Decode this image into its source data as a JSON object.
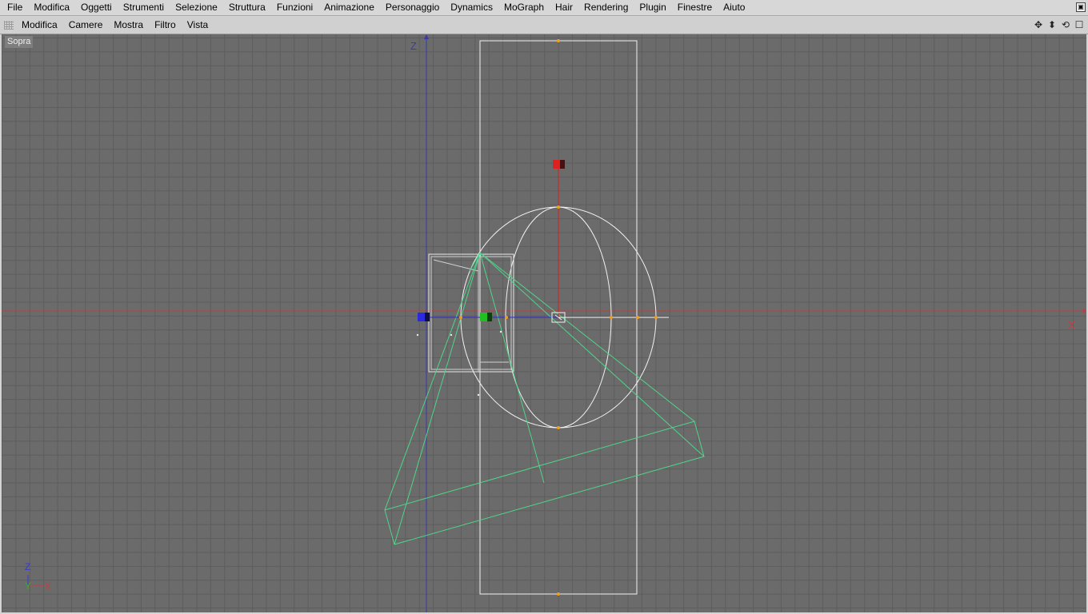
{
  "menu": [
    "File",
    "Modifica",
    "Oggetti",
    "Strumenti",
    "Selezione",
    "Struttura",
    "Funzioni",
    "Animazione",
    "Personaggio",
    "Dynamics",
    "MoGraph",
    "Hair",
    "Rendering",
    "Plugin",
    "Finestre",
    "Aiuto"
  ],
  "view_menu": [
    "Modifica",
    "Camere",
    "Mostra",
    "Filtro",
    "Vista"
  ],
  "view_icons": [
    "move-view-icon",
    "dolly-view-icon",
    "rotate-view-icon",
    "maximize-view-icon"
  ],
  "viewport": {
    "label": "Sopra",
    "axis_x_label": "X",
    "axis_z_label": "Z",
    "corner_axis": {
      "z": "Z",
      "y": "Y",
      "x": "X"
    }
  },
  "colors": {
    "viewport_bg": "#6b6b6b",
    "grid": "#5d5d5d",
    "world_x_axis": "#b84040",
    "world_z_axis": "#3a3aa8",
    "wireframe": "#f2f2f2",
    "light_cone": "#4ed58a",
    "handle_point": "#f0a020",
    "gizmo_x": "#dd2020",
    "gizmo_y": "#20c020",
    "gizmo_z": "#2a2ae0"
  }
}
